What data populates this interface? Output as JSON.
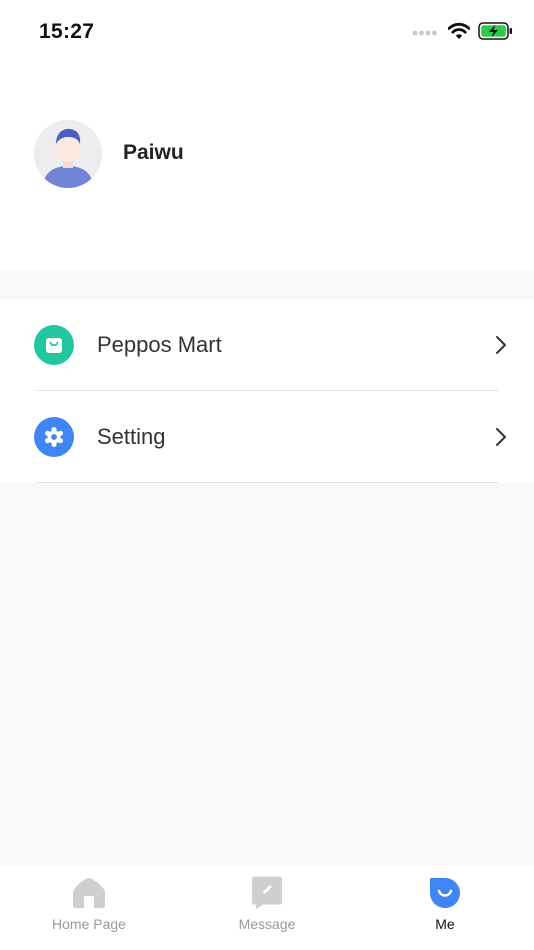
{
  "status_bar": {
    "time": "15:27",
    "icons": [
      "signal-icon",
      "wifi-icon",
      "battery-charging-icon"
    ]
  },
  "profile": {
    "name": "Paiwu",
    "avatar_icon": "avatar"
  },
  "menu": {
    "items": [
      {
        "label": "Peppos Mart",
        "icon": "shopping-bag-icon",
        "color": "#22c7a0"
      },
      {
        "label": "Setting",
        "icon": "gear-icon",
        "color": "#3f86f4"
      }
    ]
  },
  "tab_bar": {
    "tabs": [
      {
        "label": "Home Page",
        "icon": "home-icon",
        "active": false
      },
      {
        "label": "Message",
        "icon": "message-icon",
        "active": false
      },
      {
        "label": "Me",
        "icon": "me-icon",
        "active": true
      }
    ]
  },
  "colors": {
    "accent": "#3f86f4",
    "mart_green": "#22c7a0",
    "inactive_icon": "#cfcfcf",
    "background": "#f8f8f8"
  }
}
